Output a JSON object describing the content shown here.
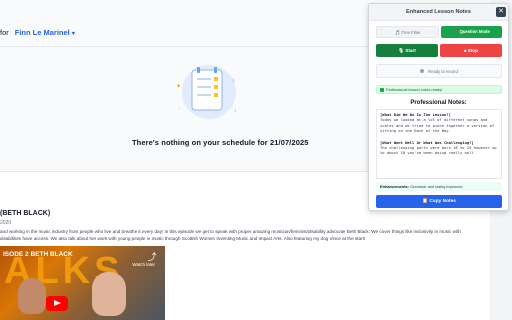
{
  "page": {
    "for_label": "for",
    "user_name": "Finn Le Marinel",
    "user_caret": "▾",
    "schedule_message": "There's nothing on your schedule for 21/07/2025"
  },
  "episode": {
    "title": "(BETH BLACK)",
    "year": "2020",
    "description": "and working in the music industry from people who live and breathe it every day! In this episode we get to speak with proper amazing musician/feminist/disability advocate Beth Black. We cover things like inclusivity in music with disabilities have access. We also talk about her work with young people in music through Scottish Women Inventing Music and Impact Arts. Also featuring my dog Vince at the start!",
    "video": {
      "title_text": "ISODE 2 BETH BLACK",
      "overlay_text": "ALKS",
      "watch_later": "Watch later",
      "share_icon": "share-icon"
    }
  },
  "panel": {
    "title": "Enhanced Lesson Notes",
    "close_label": "✕",
    "modes": {
      "free_flow": "🎵 Free Flow",
      "question_mode": "❓ Question Mode"
    },
    "controls": {
      "start": "🎙 Start",
      "stop": "⏹ Stop"
    },
    "status": "Ready to record",
    "ready_message": "Professional lesson notes ready!",
    "notes_heading": "Professional Notes:",
    "notes": {
      "q1": "[What Did We Do In The Lesson?]",
      "a1": "Today we looked at a lot of different songs and scales and we tried to piece together a version of sitting on the Dock of the Bay.",
      "q2": "[What Went Well Or What Was Challenging?]",
      "a2": "The challenging parts were bars 18 to 25 however up to about 18 you've been doing really well"
    },
    "enhancements_label": "Enhancements:",
    "enhancements_value": "Grammar and clarity improved",
    "copy_label": "📋 Copy Notes",
    "colors": {
      "primary": "#2563eb",
      "success": "#16a34a",
      "danger": "#ef4444"
    }
  }
}
